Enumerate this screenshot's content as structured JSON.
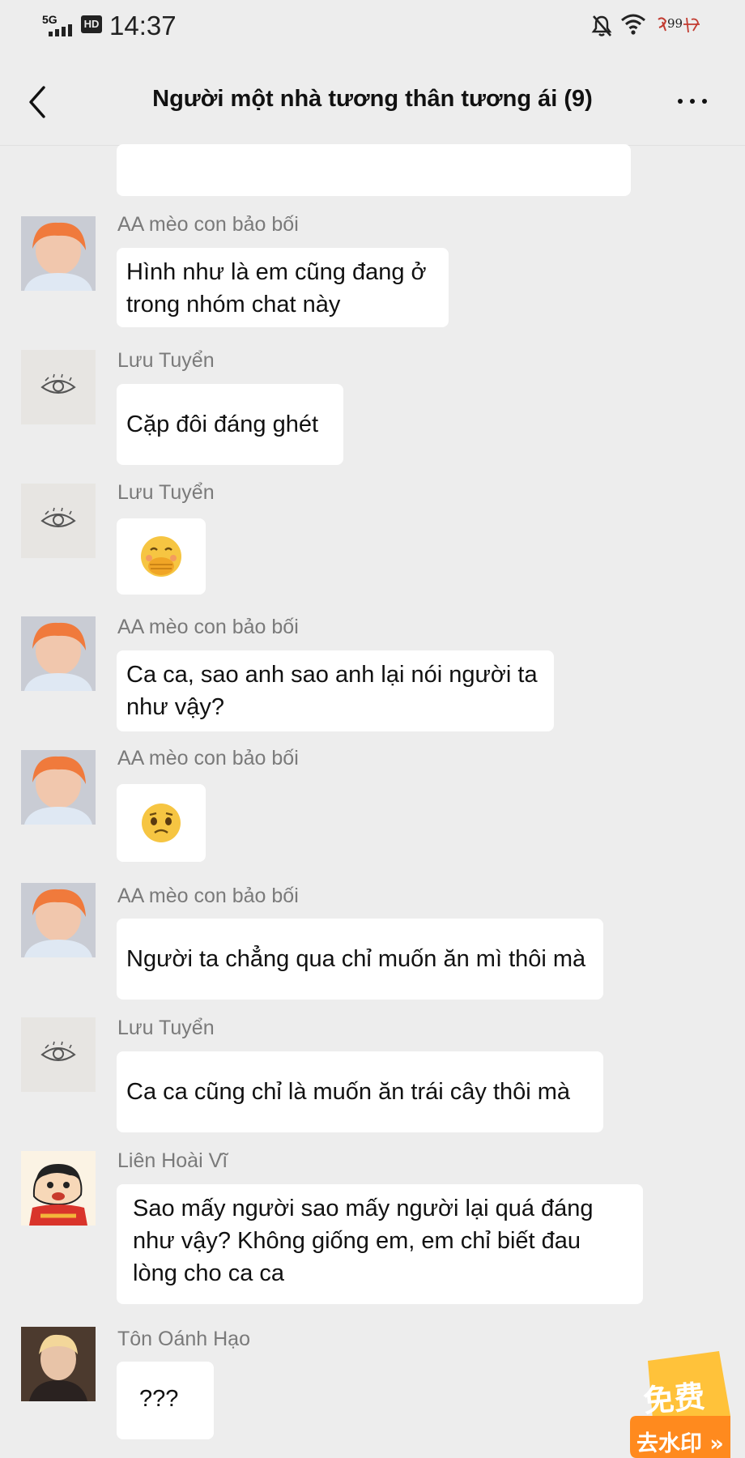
{
  "status_bar": {
    "network": "5G",
    "hd": "HD",
    "time": "14:37",
    "battery_label": "99"
  },
  "header": {
    "title": "Người một nhà tương thân tương ái (9)"
  },
  "messages": [
    {
      "sender": "AA mèo con bảo bối",
      "text": "Hình như là em cũng đang ở\ntrong nhóm chat này"
    },
    {
      "sender": "Lưu Tuyển",
      "text": "Cặp đôi đáng ghét"
    },
    {
      "sender": "Lưu Tuyển",
      "text": ""
    },
    {
      "sender": "AA mèo con bảo bối",
      "text": "Ca ca, sao anh sao anh lại nói người ta\nnhư vậy?"
    },
    {
      "sender": "AA mèo con bảo bối",
      "text": ""
    },
    {
      "sender": "AA mèo con bảo bối",
      "text": "Người ta chẳng qua chỉ muốn ăn mì thôi mà"
    },
    {
      "sender": "Lưu Tuyển",
      "text": "Ca ca cũng chỉ là muốn ăn trái cây thôi mà"
    },
    {
      "sender": "Liên Hoài Vĩ",
      "text": "Sao mấy người sao mấy người lại quá đáng\nnhư vậy? Không giống em, em chỉ biết đau\nlòng cho ca ca"
    },
    {
      "sender": "Tôn Oánh Hạo",
      "text": "???"
    }
  ],
  "promo": {
    "badge": "免费",
    "action": "去水印 »"
  }
}
